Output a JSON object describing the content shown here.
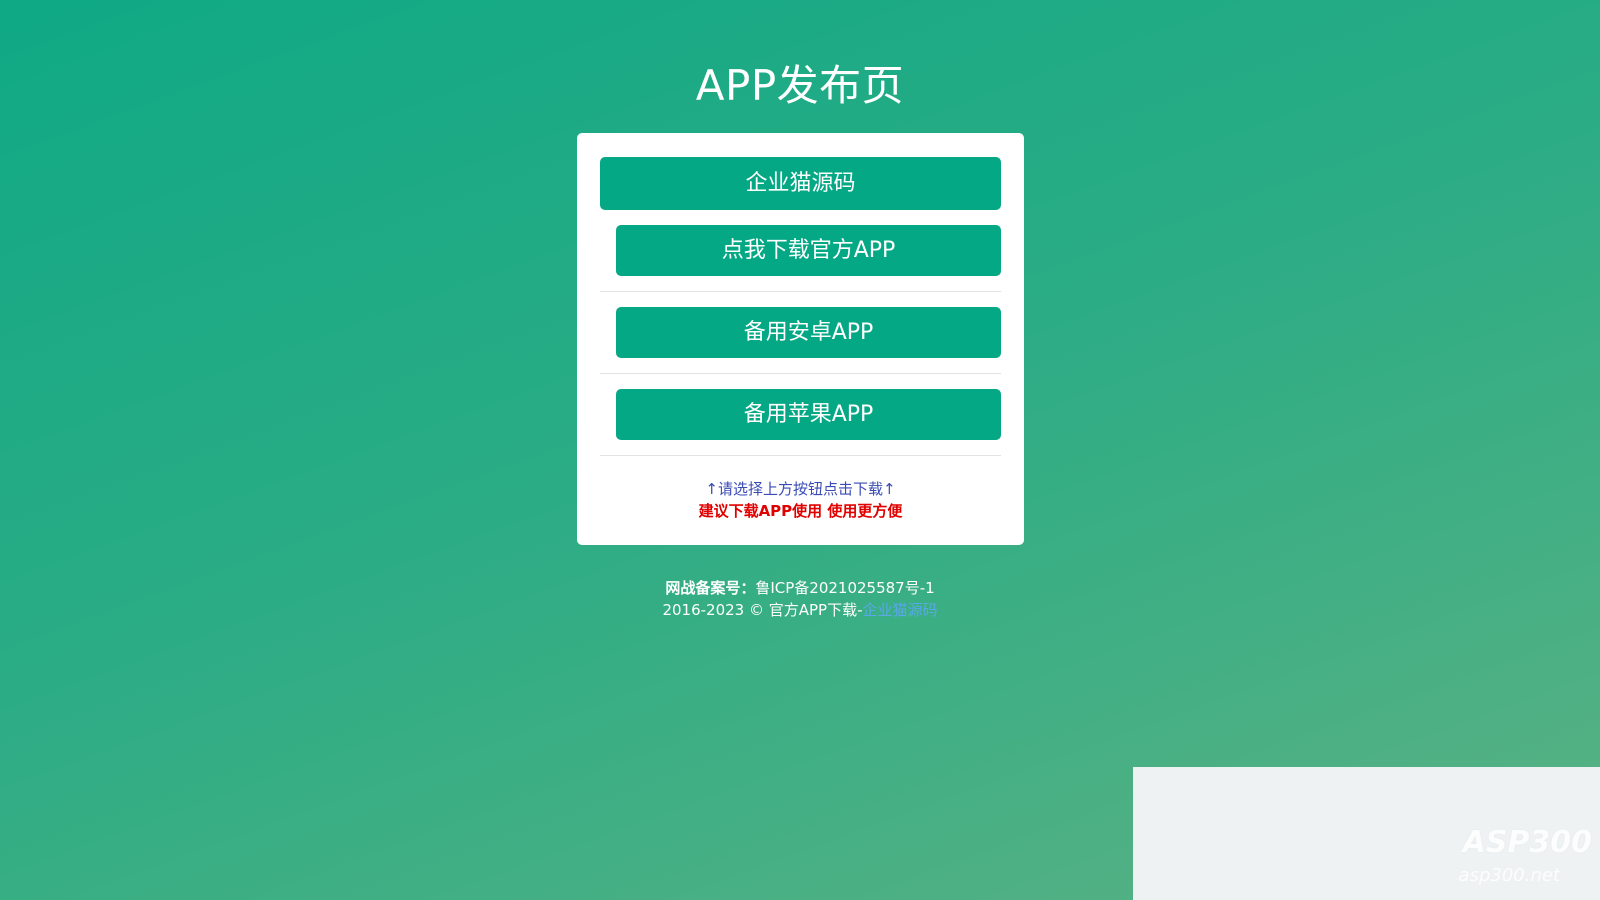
{
  "header": {
    "title": "APP发布页"
  },
  "card": {
    "main_button": "企业猫源码",
    "buttons": [
      {
        "label": "点我下载官方APP"
      },
      {
        "label": "备用安卓APP"
      },
      {
        "label": "备用苹果APP"
      }
    ],
    "hint": "↑请选择上方按钮点击下载↑",
    "recommend": "建议下载APP使用 使用更方便"
  },
  "footer": {
    "icp_label": "网战备案号：",
    "icp_value": "鲁ICP备2021025587号-1",
    "copyright_prefix": "2016-2023 © 官方APP下载-",
    "copyright_link": "企业猫源码"
  },
  "watermark": {
    "text": "ASP300",
    "sub": "asp300.net"
  },
  "colors": {
    "accent": "#05a884",
    "hint": "#3a4bb5",
    "recommend": "#e00000",
    "link": "#5aa8e8"
  }
}
